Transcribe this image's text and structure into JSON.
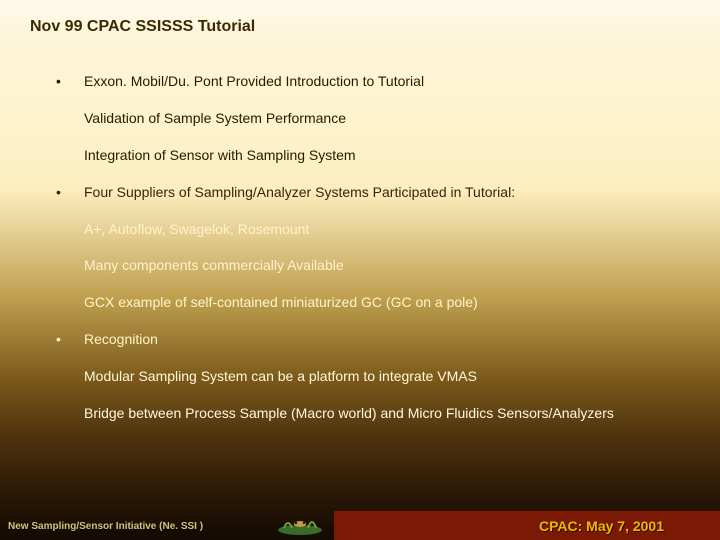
{
  "title": "Nov 99 CPAC SSISSS Tutorial",
  "items": [
    {
      "bullet": "•",
      "text": "Exxon. Mobil/Du. Pont Provided Introduction to Tutorial",
      "cls": "c1"
    },
    {
      "bullet": "",
      "text": "Validation of Sample System Performance",
      "cls": "c1"
    },
    {
      "bullet": "",
      "text": "Integration of Sensor with Sampling System",
      "cls": "c1"
    },
    {
      "bullet": "•",
      "text": "Four Suppliers of Sampling/Analyzer Systems Participated in Tutorial:",
      "cls": "c2"
    },
    {
      "bullet": "",
      "text": "A+, Autoflow, Swagelok, Rosemount",
      "cls": "c3"
    },
    {
      "bullet": "",
      "text": "Many components commercially Available",
      "cls": "c3"
    },
    {
      "bullet": "",
      "text": "GCX example of self-contained miniaturized GC (GC on a pole)",
      "cls": "c4"
    },
    {
      "bullet": "•",
      "text": "Recognition",
      "cls": "c4"
    },
    {
      "bullet": "",
      "text": "Modular Sampling System can be a platform to integrate VMAS",
      "cls": "c5"
    },
    {
      "bullet": "",
      "text": "Bridge between Process Sample (Macro world) and Micro Fluidics Sensors/Analyzers",
      "cls": "c6"
    }
  ],
  "footer": {
    "left": "New Sampling/Sensor Initiative (Ne. SSI )",
    "date": "CPAC: May 7,  2001"
  }
}
